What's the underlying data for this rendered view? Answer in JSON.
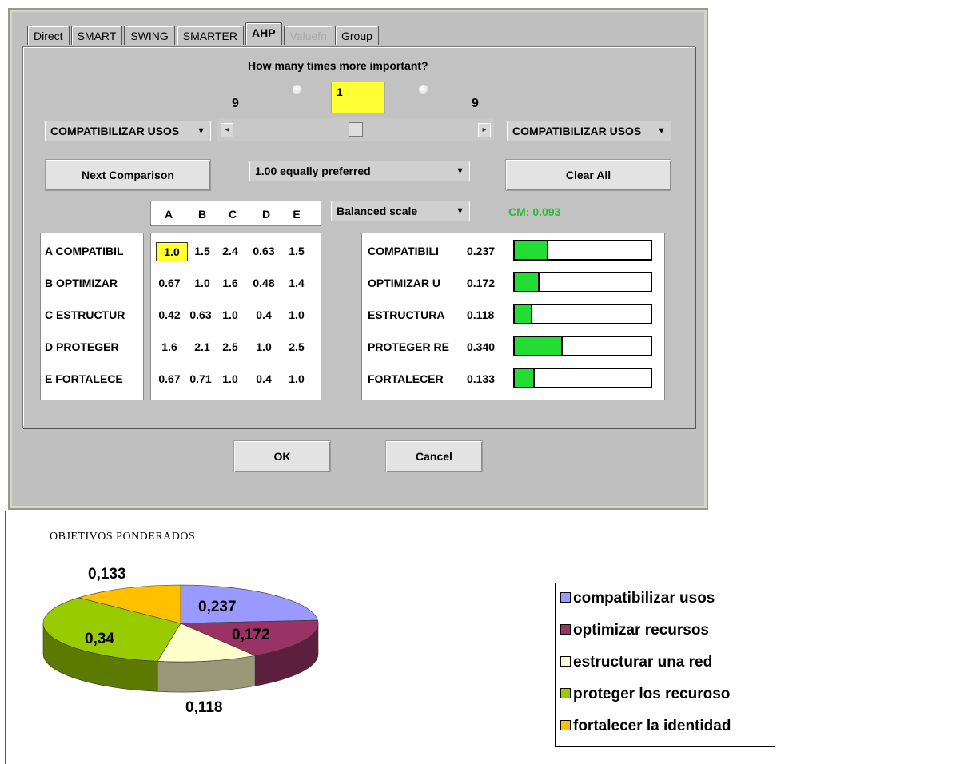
{
  "tabs": [
    {
      "label": "Direct",
      "state": "normal"
    },
    {
      "label": "SMART",
      "state": "normal"
    },
    {
      "label": "SWING",
      "state": "normal"
    },
    {
      "label": "SMARTER",
      "state": "normal"
    },
    {
      "label": "AHP",
      "state": "active"
    },
    {
      "label": "Valuefn",
      "state": "disabled"
    },
    {
      "label": "Group",
      "state": "normal"
    }
  ],
  "comparison": {
    "question": "How many times more important?",
    "left_max": "9",
    "right_max": "9",
    "value": "1",
    "left_select": "COMPATIBILIZAR USOS",
    "right_select": "COMPATIBILIZAR USOS",
    "slider_position": 0.5
  },
  "controls": {
    "next_button": "Next Comparison",
    "preference_select": "1.00 equally preferred",
    "clear_button": "Clear All",
    "scale_select": "Balanced scale",
    "consistency": "CM: 0.093"
  },
  "matrix": {
    "columns": [
      "A",
      "B",
      "C",
      "D",
      "E"
    ],
    "rows": [
      {
        "label": "A COMPATIBIL",
        "values": [
          "1.0",
          "1.5",
          "2.4",
          "0.63",
          "1.5"
        ]
      },
      {
        "label": "B OPTIMIZAR",
        "values": [
          "0.67",
          "1.0",
          "1.6",
          "0.48",
          "1.4"
        ]
      },
      {
        "label": "C ESTRUCTUR",
        "values": [
          "0.42",
          "0.63",
          "1.0",
          "0.4",
          "1.0"
        ]
      },
      {
        "label": "D PROTEGER",
        "values": [
          "1.6",
          "2.1",
          "2.5",
          "1.0",
          "2.5"
        ]
      },
      {
        "label": "E FORTALECE",
        "values": [
          "0.67",
          "0.71",
          "1.0",
          "0.4",
          "1.0"
        ]
      }
    ]
  },
  "results": [
    {
      "label": "COMPATIBILI",
      "value": "0.237",
      "weight": 0.237
    },
    {
      "label": "OPTIMIZAR U",
      "value": "0.172",
      "weight": 0.172
    },
    {
      "label": "ESTRUCTURA",
      "value": "0.118",
      "weight": 0.118
    },
    {
      "label": "PROTEGER RE",
      "value": "0.340",
      "weight": 0.34
    },
    {
      "label": "FORTALECER",
      "value": "0.133",
      "weight": 0.133
    }
  ],
  "dialog_buttons": {
    "ok": "OK",
    "cancel": "Cancel"
  },
  "chart_data": {
    "type": "pie",
    "title": "OBJETIVOS  PONDERADOS",
    "slices": [
      {
        "name": "compatibilizar usos",
        "value": 0.237,
        "label": "0,237",
        "color": "#9999ff"
      },
      {
        "name": "optimizar recursos",
        "value": 0.172,
        "label": "0,172",
        "color": "#993366"
      },
      {
        "name": "estructurar una red",
        "value": 0.118,
        "label": "0,118",
        "color": "#ffffcc"
      },
      {
        "name": "proteger los recuroso",
        "value": 0.34,
        "label": "0,34",
        "color": "#99cc00"
      },
      {
        "name": "fortalecer la identidad",
        "value": 0.133,
        "label": "0,133",
        "color": "#ffc000"
      }
    ],
    "legend": "right"
  }
}
